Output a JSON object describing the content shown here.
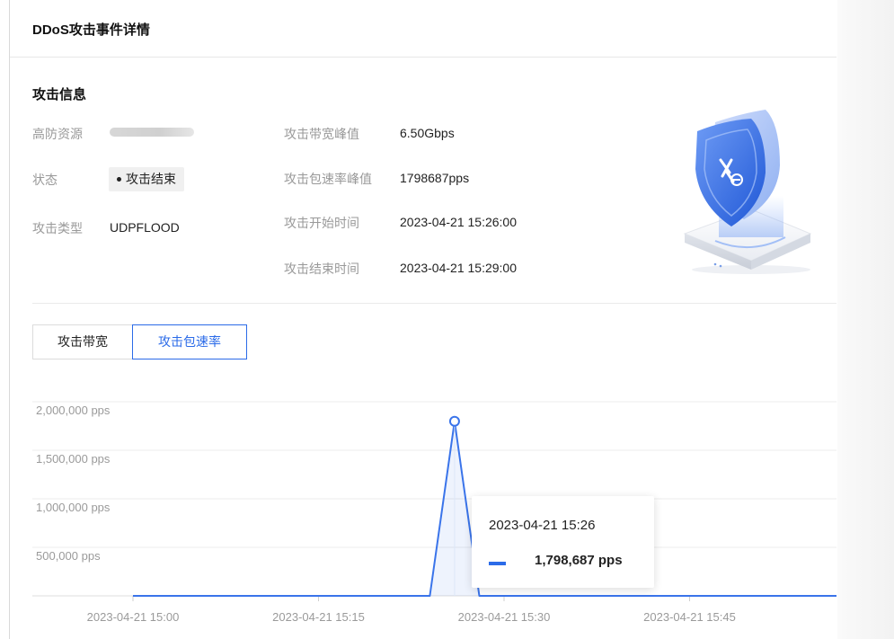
{
  "page": {
    "title": "DDoS攻击事件详情",
    "section_title": "攻击信息"
  },
  "info": {
    "resource_label": "高防资源",
    "status_label": "状态",
    "status_value": "攻击结束",
    "type_label": "攻击类型",
    "type_value": "UDPFLOOD",
    "bandwidth_peak_label": "攻击带宽峰值",
    "bandwidth_peak_value": "6.50Gbps",
    "pps_peak_label": "攻击包速率峰值",
    "pps_peak_value": "1798687pps",
    "start_time_label": "攻击开始时间",
    "start_time_value": "2023-04-21 15:26:00",
    "end_time_label": "攻击结束时间",
    "end_time_value": "2023-04-21 15:29:00"
  },
  "tabs": [
    {
      "label": "攻击带宽",
      "active": false
    },
    {
      "label": "攻击包速率",
      "active": true
    }
  ],
  "tooltip": {
    "time": "2023-04-21 15:26",
    "value": "1,798,687 pps"
  },
  "colors": {
    "accent": "#2b6be8",
    "line": "#3a74ea"
  },
  "chart_data": {
    "type": "line",
    "x": [
      "2023-04-21 14:57",
      "2023-04-21 15:24",
      "2023-04-21 15:26",
      "2023-04-21 15:28",
      "2023-04-21 15:29",
      "2023-04-21 16:00"
    ],
    "series": [
      {
        "values": [
          0,
          0,
          1798687,
          0,
          0,
          0
        ]
      }
    ],
    "xticks": [
      "2023-04-21 15:00",
      "2023-04-21 15:15",
      "2023-04-21 15:30",
      "2023-04-21 15:45"
    ],
    "yticks": [
      "500,000 pps",
      "1,000,000 pps",
      "1,500,000 pps",
      "2,000,000 pps"
    ],
    "ylim": [
      0,
      2000000
    ],
    "grid": true,
    "highlight_point": {
      "x": "2023-04-21 15:26",
      "y": 1798687
    }
  }
}
